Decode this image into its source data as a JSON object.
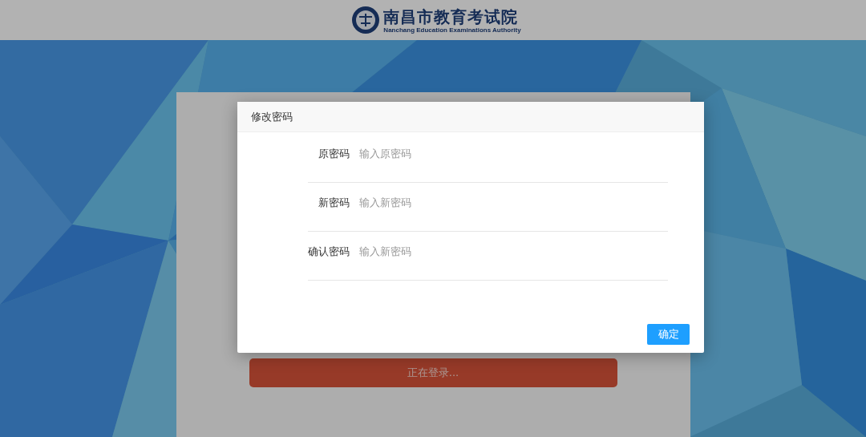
{
  "header": {
    "logo_title": "南昌市教育考试院",
    "logo_subtitle": "Nanchang Education Examinations Authority"
  },
  "login": {
    "button": "正在登录..."
  },
  "dialog": {
    "title": "修改密码",
    "fields": [
      {
        "label": "原密码",
        "placeholder": "输入原密码"
      },
      {
        "label": "新密码",
        "placeholder": "输入新密码"
      },
      {
        "label": "确认密码",
        "placeholder": "输入新密码"
      }
    ],
    "confirm": "确定"
  }
}
